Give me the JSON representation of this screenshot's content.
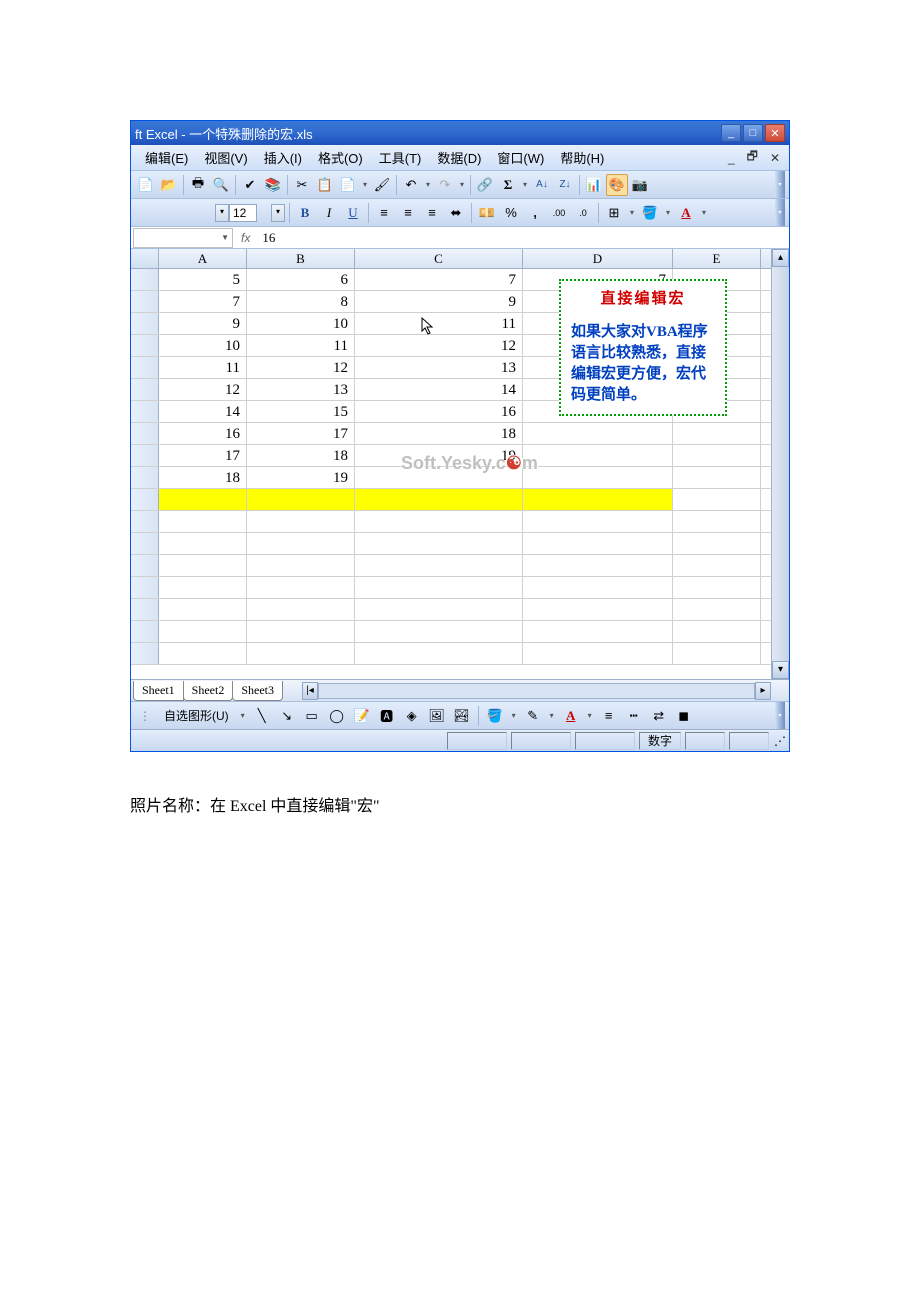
{
  "title_bar": "ft Excel - 一个特殊删除的宏.xls",
  "menu": {
    "edit": "编辑(E)",
    "view": "视图(V)",
    "insert": "插入(I)",
    "format": "格式(O)",
    "tools": "工具(T)",
    "data": "数据(D)",
    "window": "窗口(W)",
    "help": "帮助(H)"
  },
  "font_size": "12",
  "formula_value": "16",
  "columns": [
    "A",
    "B",
    "C",
    "D",
    "E"
  ],
  "rows": [
    {
      "a": "5",
      "b": "6",
      "c": "7",
      "d": "7",
      "e": ""
    },
    {
      "a": "7",
      "b": "8",
      "c": "9",
      "d": "",
      "e": ""
    },
    {
      "a": "9",
      "b": "10",
      "c": "11",
      "d": "",
      "e": ""
    },
    {
      "a": "10",
      "b": "11",
      "c": "12",
      "d": "",
      "e": ""
    },
    {
      "a": "11",
      "b": "12",
      "c": "13",
      "d": "",
      "e": ""
    },
    {
      "a": "12",
      "b": "13",
      "c": "14",
      "d": "",
      "e": ""
    },
    {
      "a": "14",
      "b": "15",
      "c": "16",
      "d": "",
      "e": ""
    },
    {
      "a": "16",
      "b": "17",
      "c": "18",
      "d": "",
      "e": ""
    },
    {
      "a": "17",
      "b": "18",
      "c": "19",
      "d": "",
      "e": ""
    },
    {
      "a": "18",
      "b": "19",
      "c": "",
      "d": "",
      "e": ""
    }
  ],
  "callout": {
    "title": "直接编辑宏",
    "body": "如果大家对VBA程序语言比较熟悉，直接编辑宏更方便，宏代码更简单。"
  },
  "watermark": "Soft.Yesky.c",
  "watermark_end": "m",
  "sheets": [
    "Sheet1",
    "Sheet2",
    "Sheet3"
  ],
  "drawing_label": "自选图形(U)",
  "status_text": "数字",
  "caption": "照片名称：在 Excel 中直接编辑\"宏\"",
  "format_labels": {
    "bold": "B",
    "italic": "I",
    "underline": "U",
    "percent": "%",
    "comma": ",",
    "sigma": "Σ",
    "currency": "¥"
  }
}
